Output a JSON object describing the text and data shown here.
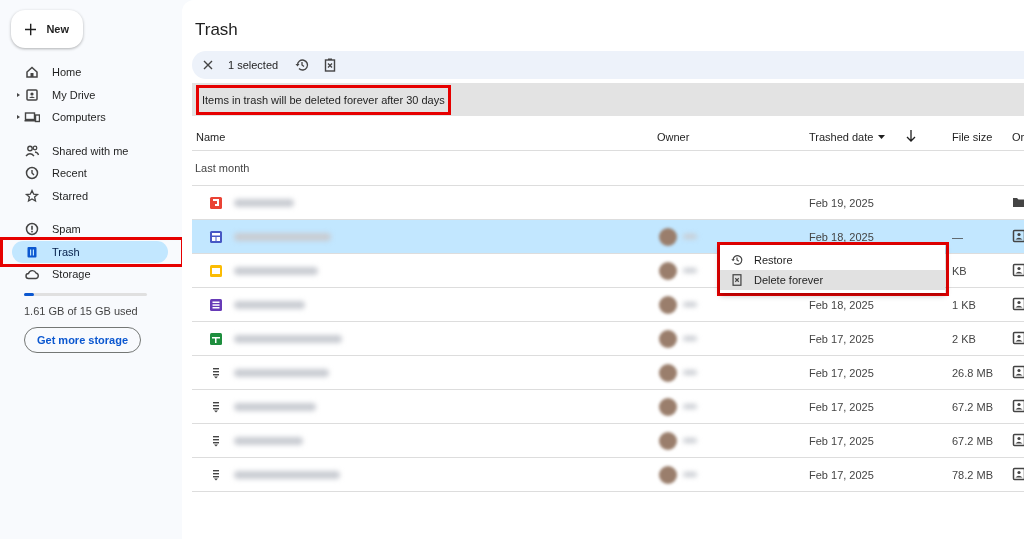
{
  "sidebar": {
    "new_button": "New",
    "groups": [
      [
        {
          "label": "Home",
          "kind": "home",
          "has_children": false,
          "selected": false,
          "annotated": false
        },
        {
          "label": "My Drive",
          "kind": "drive",
          "has_children": true,
          "selected": false,
          "annotated": false
        },
        {
          "label": "Computers",
          "kind": "computer",
          "has_children": true,
          "selected": false,
          "annotated": false
        }
      ],
      [
        {
          "label": "Shared with me",
          "kind": "people",
          "has_children": false,
          "selected": false,
          "annotated": false
        },
        {
          "label": "Recent",
          "kind": "clock",
          "has_children": false,
          "selected": false,
          "annotated": false
        },
        {
          "label": "Starred",
          "kind": "star",
          "has_children": false,
          "selected": false,
          "annotated": false
        }
      ],
      [
        {
          "label": "Spam",
          "kind": "spam",
          "has_children": false,
          "selected": false,
          "annotated": false
        },
        {
          "label": "Trash",
          "kind": "trash",
          "has_children": false,
          "selected": true,
          "annotated": true
        },
        {
          "label": "Storage",
          "kind": "cloud",
          "has_children": false,
          "selected": false,
          "annotated": false
        }
      ]
    ],
    "storage": {
      "level": 0.08,
      "usage": "1.61 GB of 15 GB used",
      "button": "Get more storage"
    }
  },
  "main": {
    "title": "Trash",
    "selection_bar": {
      "count": "1 selected"
    },
    "notice": {
      "text": "Items in trash will be deleted forever after 30 days",
      "annotated": true
    },
    "table": {
      "columns": [
        "Name",
        "Owner",
        "Trashed date",
        "File size",
        "Or"
      ],
      "group": "Last month",
      "rows": [
        {
          "kind": "pdf",
          "selected": false,
          "owner_avatar": false,
          "date": "Feb 19, 2025",
          "location": {
            "kind": "folder"
          }
        },
        {
          "kind": "site",
          "selected": true,
          "owner_avatar": true,
          "date": "Feb 18, 2025",
          "size": "—",
          "location": {
            "kind": "drive"
          }
        },
        {
          "kind": "slides",
          "selected": false,
          "owner_avatar": true,
          "size": "KB",
          "location": {
            "kind": "drive"
          }
        },
        {
          "kind": "form",
          "selected": false,
          "owner_avatar": true,
          "date": "Feb 18, 2025",
          "size": "1 KB",
          "location": {
            "kind": "drive"
          }
        },
        {
          "kind": "sheet",
          "selected": false,
          "owner_avatar": true,
          "date": "Feb 17, 2025",
          "size": "2 KB",
          "location": {
            "kind": "drive"
          }
        },
        {
          "kind": "zip",
          "selected": false,
          "owner_avatar": true,
          "date": "Feb 17, 2025",
          "size": "26.8 MB",
          "location": {
            "kind": "drive"
          }
        },
        {
          "kind": "zip",
          "selected": false,
          "owner_avatar": true,
          "date": "Feb 17, 2025",
          "size": "67.2 MB",
          "location": {
            "kind": "drive"
          }
        },
        {
          "kind": "zip",
          "selected": false,
          "owner_avatar": true,
          "date": "Feb 17, 2025",
          "size": "67.2 MB",
          "location": {
            "kind": "drive"
          }
        },
        {
          "kind": "zip",
          "selected": false,
          "owner_avatar": true,
          "date": "Feb 17, 2025",
          "size": "78.2 MB",
          "location": {
            "kind": "drive"
          }
        }
      ]
    },
    "context_menu": {
      "annotated": true,
      "items": [
        {
          "label": "Restore",
          "kind": "restore",
          "highlighted": false
        },
        {
          "label": "Delete forever",
          "kind": "delete",
          "highlighted": true
        }
      ]
    }
  }
}
